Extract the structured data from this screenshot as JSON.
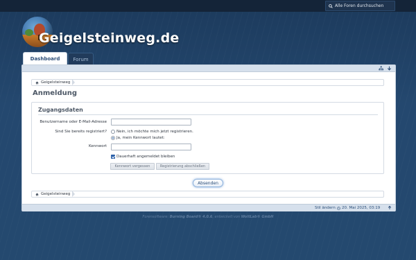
{
  "header": {
    "search_placeholder": "Alle Foren durchsuchen",
    "site_title": "Geigelsteinweg.de"
  },
  "tabs": [
    {
      "label": "Dashboard",
      "active": true
    },
    {
      "label": "Forum",
      "active": false
    }
  ],
  "breadcrumb": {
    "home_label": "Geigelsteinweg"
  },
  "page": {
    "title": "Anmeldung"
  },
  "form": {
    "legend": "Zugangsdaten",
    "username_label": "Benutzername oder E-Mail-Adresse",
    "username_value": "",
    "registered_label": "Sind Sie bereits registriert?",
    "radio_no_label": "Nein, ich möchte mich jetzt registrieren.",
    "radio_yes_label": "Ja, mein Kennwort lautet:",
    "radio_selected": "yes",
    "password_label": "Kennwort",
    "password_value": "",
    "remember_label": "Dauerhaft angemeldet bleiben",
    "remember_checked": true,
    "forgot_button": "Kennwort vergessen",
    "finish_registration_button": "Registrierung abschließen",
    "submit_button": "Absenden"
  },
  "footer": {
    "style_link": "Stil ändern",
    "datetime": "20. Mai 2025, 03:19"
  },
  "copyright": {
    "prefix": "Forensoftware: ",
    "product": "Burning Board® 4.0.6",
    "middle": ", entwickelt von ",
    "vendor": "WoltLab® GmbH"
  },
  "icons": {
    "search": "search-icon",
    "home": "home-icon",
    "sitemap": "sitemap-icon",
    "down": "arrow-down-icon",
    "clock": "clock-icon",
    "up": "arrow-up-icon"
  },
  "colors": {
    "background": "#24486f",
    "topbar": "#142438",
    "accent": "#2c4e78",
    "panel_bar": "#d6e0ec"
  }
}
